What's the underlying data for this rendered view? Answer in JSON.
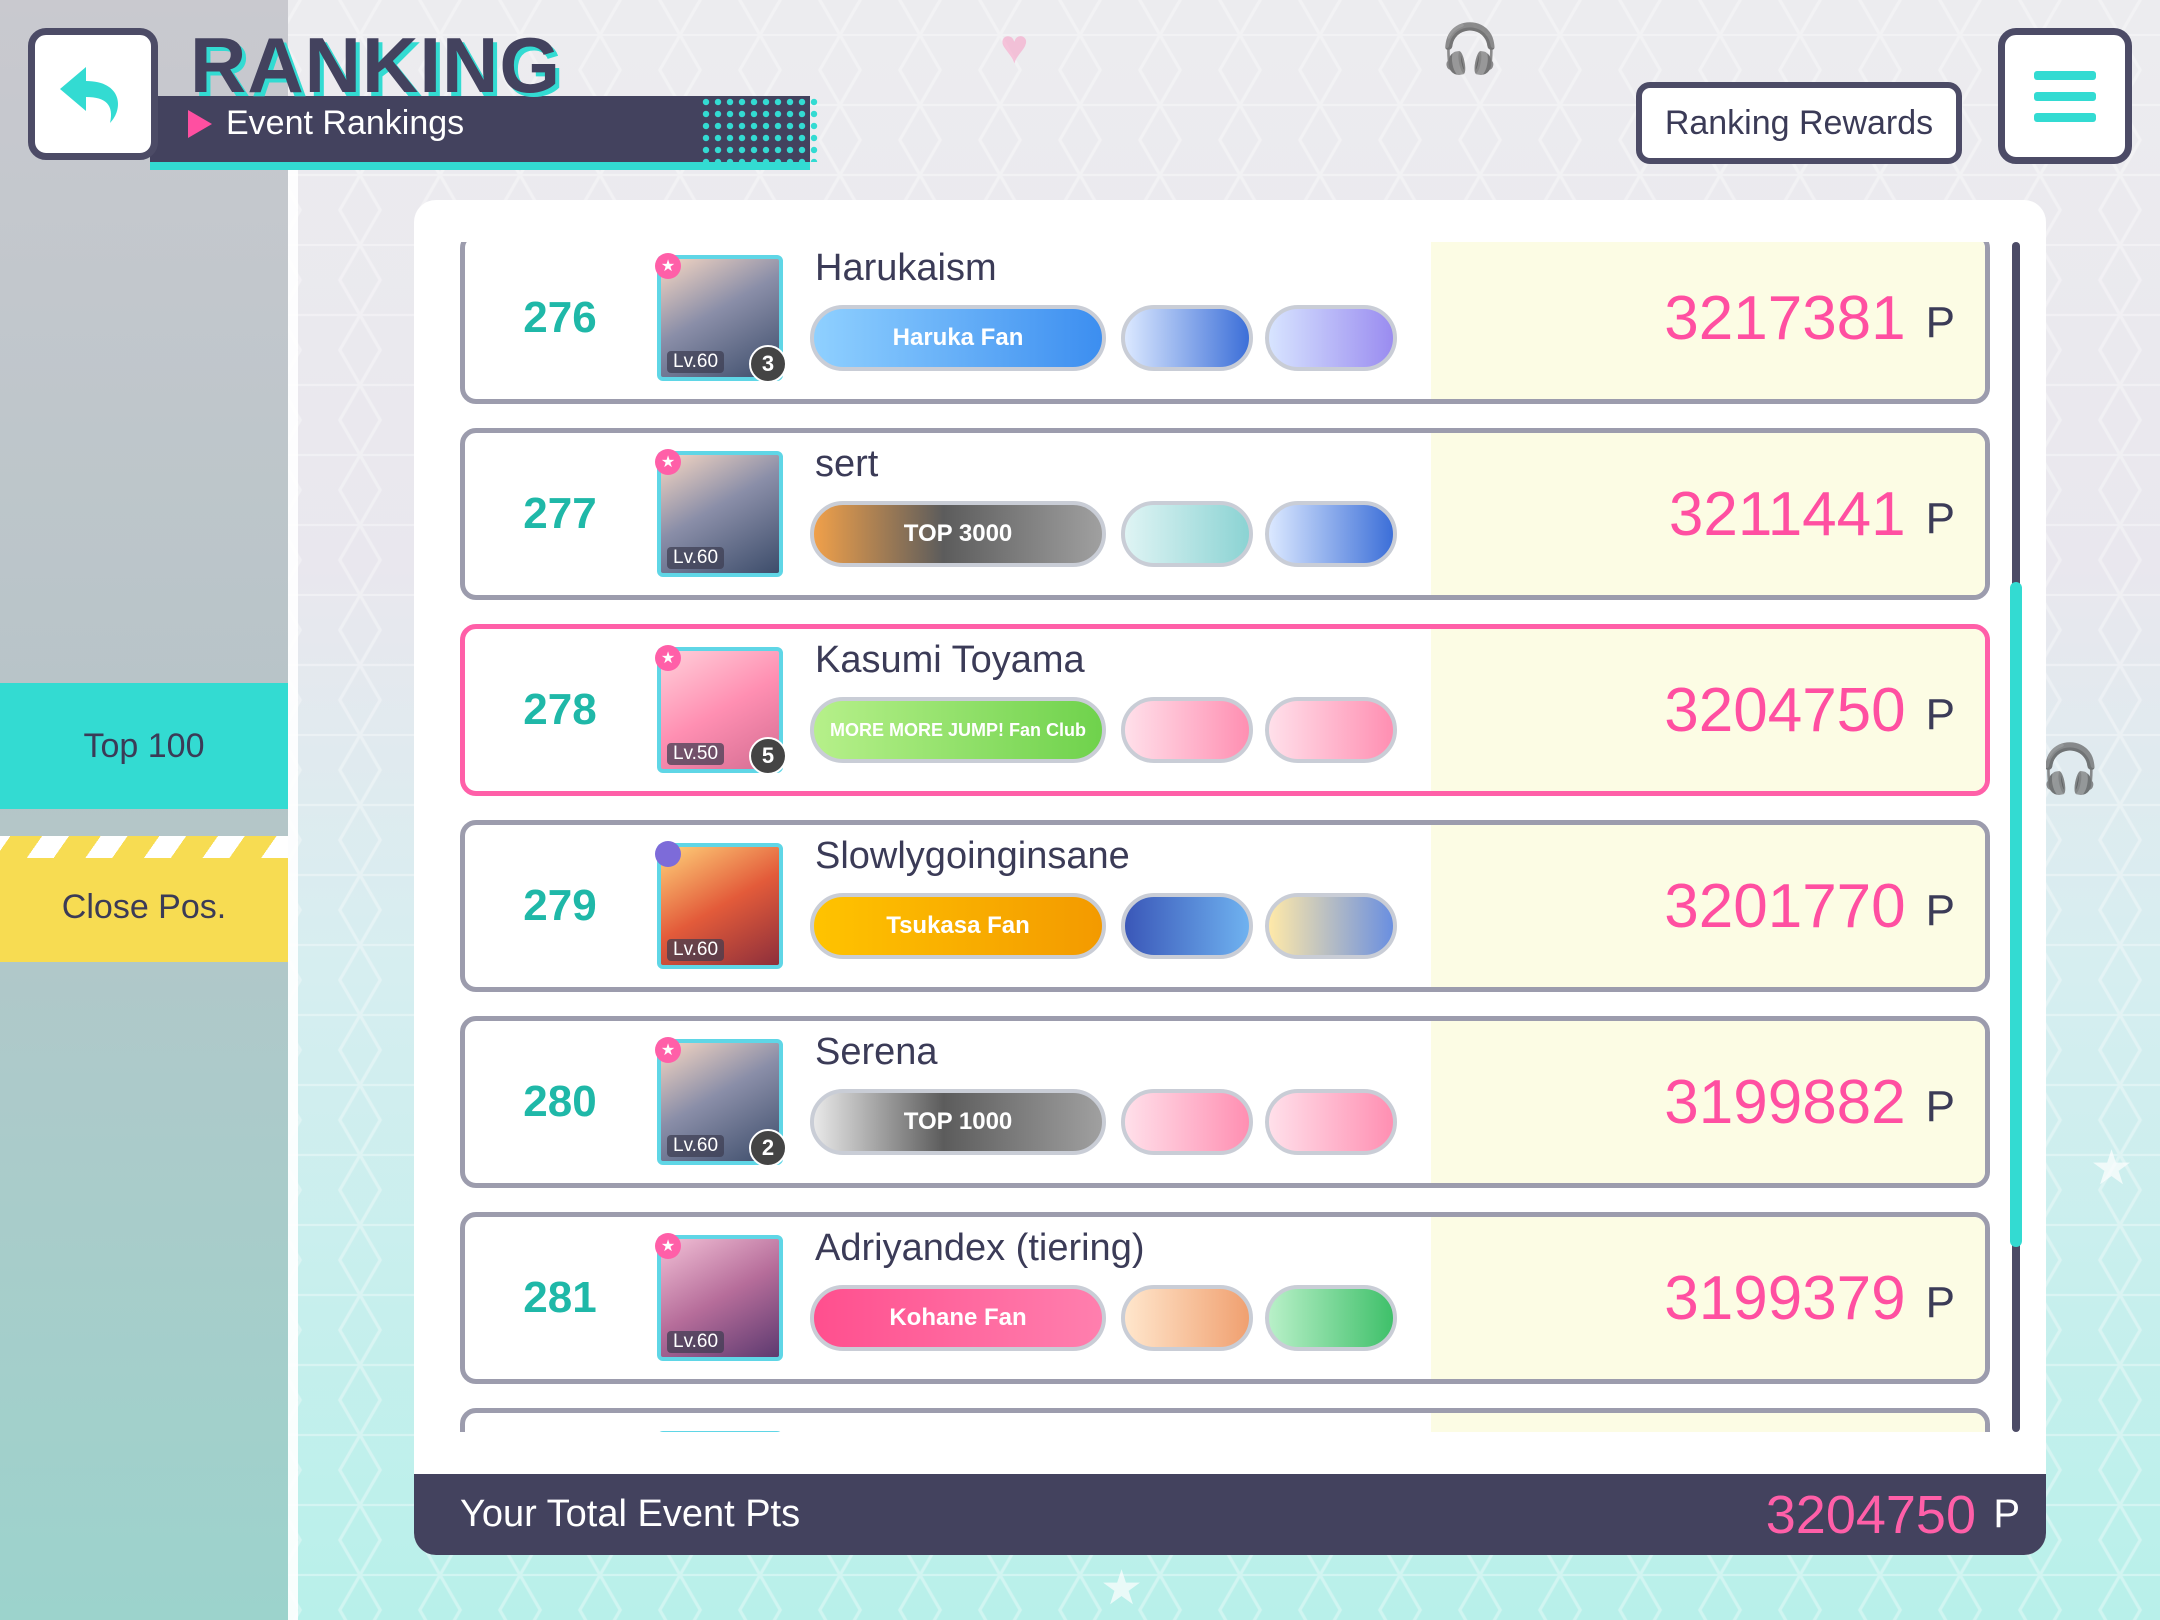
{
  "header": {
    "title": "RANKING",
    "subtitle": "Event Rankings",
    "rewards_label": "Ranking Rewards"
  },
  "sidebar": {
    "tabs": [
      {
        "label": "Top 100",
        "color": "#33dbd2"
      },
      {
        "label": "Close Pos.",
        "color": "#f7dc52"
      }
    ]
  },
  "rows": [
    {
      "rank": "276",
      "name": "Harukaism",
      "score": "3217381",
      "unit": "P",
      "level": "Lv.60",
      "mastery": "3",
      "title": "Haruka Fan",
      "highlight": false
    },
    {
      "rank": "277",
      "name": "sert",
      "score": "3211441",
      "unit": "P",
      "level": "Lv.60",
      "mastery": "",
      "title": "TOP 3000",
      "highlight": false
    },
    {
      "rank": "278",
      "name": "Kasumi Toyama",
      "score": "3204750",
      "unit": "P",
      "level": "Lv.50",
      "mastery": "5",
      "title": "MORE MORE JUMP! Fan Club",
      "highlight": true
    },
    {
      "rank": "279",
      "name": "Slowlygoinginsane",
      "score": "3201770",
      "unit": "P",
      "level": "Lv.60",
      "mastery": "",
      "title": "Tsukasa Fan",
      "highlight": false
    },
    {
      "rank": "280",
      "name": "Serena",
      "score": "3199882",
      "unit": "P",
      "level": "Lv.60",
      "mastery": "2",
      "title": "TOP 1000",
      "highlight": false
    },
    {
      "rank": "281",
      "name": "Adriyandex (tiering)",
      "score": "3199379",
      "unit": "P",
      "level": "Lv.60",
      "mastery": "",
      "title": "Kohane Fan",
      "highlight": false
    }
  ],
  "footer": {
    "label": "Your Total Event Pts",
    "total": "3204750",
    "unit": "P"
  },
  "colors": {
    "accent": "#33dbd2",
    "score_pink": "#ff4fa1",
    "dark": "#43425e"
  }
}
